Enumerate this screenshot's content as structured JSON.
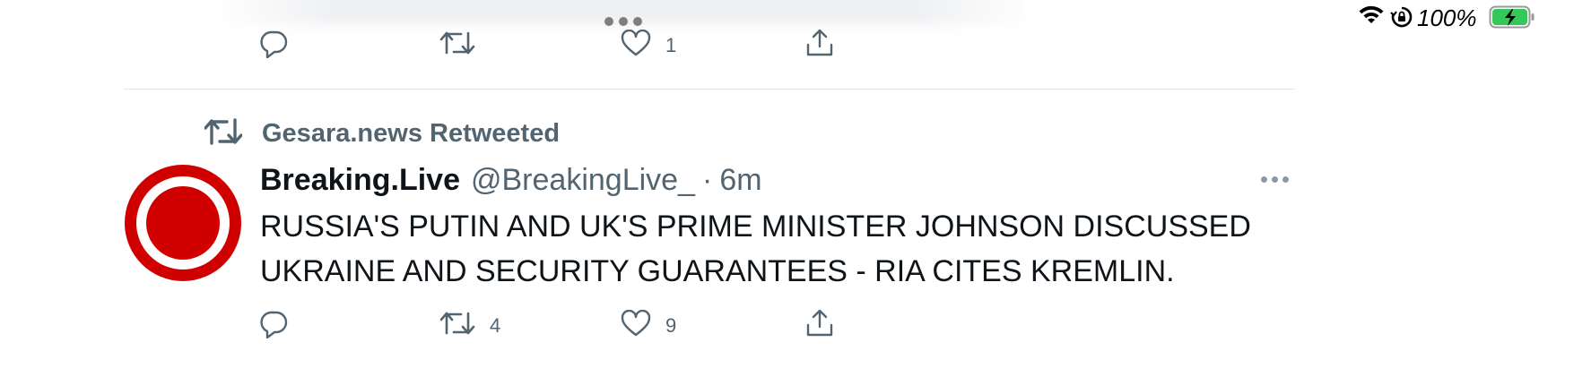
{
  "status_bar": {
    "battery_percent": "100%",
    "icons": [
      "wifi-icon",
      "orientation-lock-icon",
      "battery-charging-icon"
    ],
    "battery_color": "#34c759"
  },
  "previous_tweet": {
    "reply_icon": "reply-icon",
    "retweet_icon": "retweet-icon",
    "like_icon": "heart-icon",
    "like_count": "1",
    "share_icon": "share-icon"
  },
  "retweet_context": {
    "icon": "retweet-icon",
    "label": "Gesara.news Retweeted"
  },
  "tweet": {
    "avatar_icon": "breaking-live-logo",
    "avatar_color": "#d00000",
    "display_name": "Breaking.Live",
    "handle": "@BreakingLive_",
    "separator": "·",
    "time": "6m",
    "text_line_1": "RUSSIA'S PUTIN AND UK'S PRIME MINISTER JOHNSON DISCUSSED",
    "text_line_2": "UKRAINE AND SECURITY GUARANTEES - RIA CITES KREMLIN.",
    "more_icon": "more-icon",
    "actions": {
      "reply_count": "",
      "retweet_count": "4",
      "like_count": "9"
    }
  },
  "colors": {
    "secondary_text": "#536471",
    "primary_text": "#0f1419",
    "divider": "#e1e4e8"
  }
}
